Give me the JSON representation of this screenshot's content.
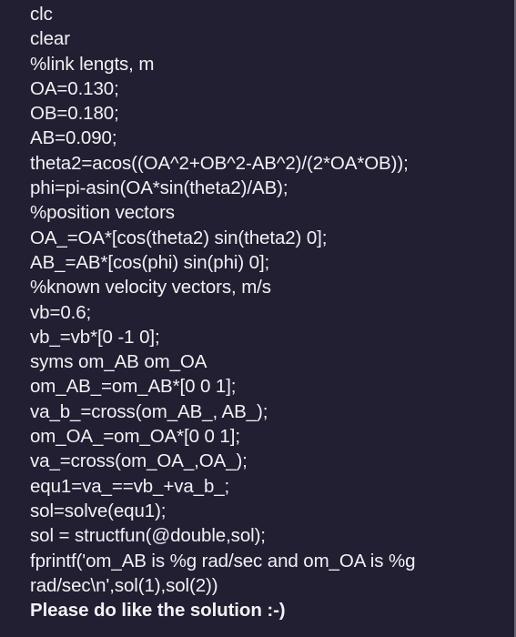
{
  "code": {
    "lines": [
      "clc",
      "clear",
      "%link lengts, m",
      "OA=0.130;",
      "OB=0.180;",
      "AB=0.090;",
      "theta2=acos((OA^2+OB^2-AB^2)/(2*OA*OB));",
      "phi=pi-asin(OA*sin(theta2)/AB);",
      "%position vectors",
      "OA_=OA*[cos(theta2) sin(theta2) 0];",
      "AB_=AB*[cos(phi) sin(phi) 0];",
      "%known velocity vectors, m/s",
      "vb=0.6;",
      "vb_=vb*[0 -1 0];",
      "syms om_AB om_OA",
      "om_AB_=om_AB*[0 0 1];",
      "va_b_=cross(om_AB_, AB_);",
      "om_OA_=om_OA*[0 0 1];",
      "va_=cross(om_OA_,OA_);",
      "equ1=va_==vb_+va_b_;",
      "sol=solve(equ1);",
      "sol = structfun(@double,sol);",
      "fprintf('om_AB is %g rad/sec and om_OA is %g",
      "rad/sec\\n',sol(1),sol(2))"
    ]
  },
  "closing_note": "Please do like the solution :-)"
}
